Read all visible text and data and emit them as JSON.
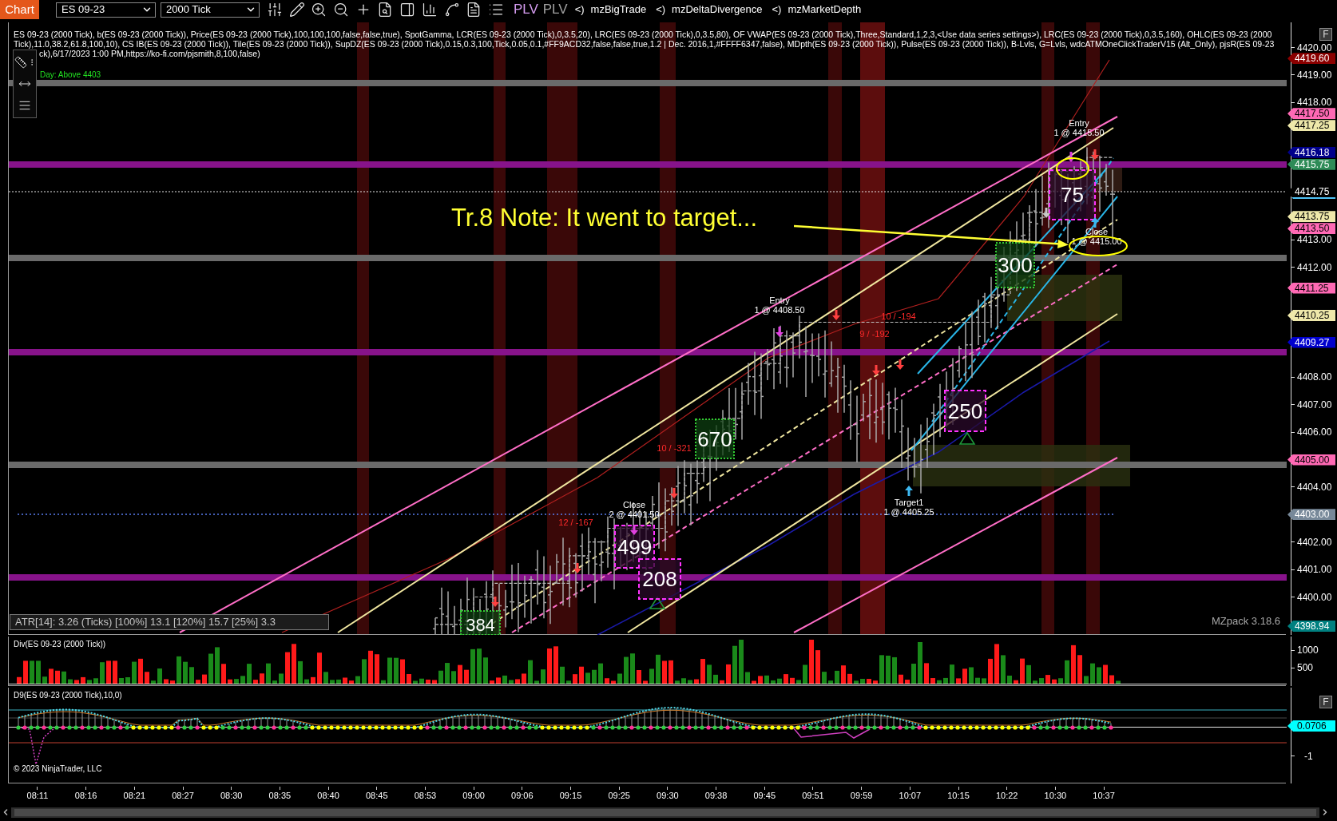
{
  "toolbar": {
    "tab": "Chart",
    "instrument": "ES 09-23",
    "interval": "2000 Tick",
    "plv": [
      {
        "label": "PLV",
        "on": true
      },
      {
        "label": "PLV",
        "on": false
      }
    ],
    "addons": [
      {
        "glyph": "<)",
        "label": "mzBigTrade"
      },
      {
        "glyph": "<)",
        "label": "mzDeltaDivergence"
      },
      {
        "glyph": "<)",
        "label": "mzMarketDepth"
      }
    ]
  },
  "price_panel": {
    "indicator_lines": [
      "ES 09-23 (2000 Tick), b(ES 09-23 (2000 Tick)), Price(ES 09-23 (2000 Tick),100,100,100,false,false,true), SpotGamma, LCR(ES 09-23 (2000 Tick),0,3.5,20), LRC(ES 09-23 (2000 Tick),0,3.5,80), OF VWAP(ES 09-23 (2000 Tick),Three,Standard,1,2,3,<Use data series settings>), LRC(ES 09-23 (2000 Tick),0,3.5,160), OHLC(ES 09-23 (2000",
      "Tick),11.0,38.2,61.8,100,10), CS IB(ES 09-23 (2000 Tick)), Tile(ES 09-23 (2000 Tick)), SupDZ(ES 09-23 (2000 Tick),0.15,0.3,100,Tick,0.05,0.1,#FF9ACD32,false,false,true,1.2 | Dec. 2016,1,#FFFF6347,false), MDpth(ES 09-23 (2000 Tick)), Pulse(ES 09-23 (2000 Tick)), B-Lvls, G=Lvls, wdcATMOneClickTraderV15 (Alt_Only), pjsR(ES 09-23",
      "ck),6/17/2023 1:00 PM,https://ko-fi.com/pjsmith,8,100,false)"
    ],
    "day_label": "Day: Above 4403",
    "note": "Tr.8 Note: It went to target...",
    "trade_labels": [
      {
        "title": "Entry",
        "detail": "1 @ 4408.50"
      },
      {
        "title": "Entry",
        "detail": "1 @ 4415.50"
      },
      {
        "title": "Close",
        "detail": "1 @ 4415.00"
      },
      {
        "title": "Close",
        "detail": "2 @ 4401.50"
      },
      {
        "title": "Target1",
        "detail": "1 @ 4405.25"
      }
    ],
    "pnl_labels": [
      "10 / -194",
      "9 / -192",
      "10 / -321",
      "12 / -167"
    ],
    "clusters": [
      {
        "kind": "buy",
        "value": "670"
      },
      {
        "kind": "sell",
        "value": "250"
      },
      {
        "kind": "buy",
        "value": "300"
      },
      {
        "kind": "sell",
        "value": "75"
      },
      {
        "kind": "sell",
        "value": "499"
      },
      {
        "kind": "sell",
        "value": "208"
      },
      {
        "kind": "buy",
        "value": "384"
      }
    ],
    "atr": "ATR[14]: 3.26 (Ticks) [100%] 13.1 [120%] 15.7 [25%] 3.3",
    "version": "MZpack 3.18.6"
  },
  "price_axis": {
    "f_button": "F",
    "ticks": [
      "4420.00",
      "4419.00",
      "4418.00",
      "4413.00",
      "4412.00",
      "4408.00",
      "4407.00",
      "4406.00",
      "4404.00",
      "4402.00",
      "4401.00",
      "4400.00"
    ],
    "markers": [
      {
        "kind": "level",
        "label": "4419.60",
        "color": "#8b0000"
      },
      {
        "kind": "level",
        "label": "4417.50",
        "color": "#ff69b4"
      },
      {
        "kind": "level",
        "label": "4417.25",
        "color": "#eee8aa"
      },
      {
        "kind": "level",
        "label": "4416.18",
        "color": "#00008b"
      },
      {
        "kind": "level",
        "label": "4415.75",
        "color": "#2e8b57"
      },
      {
        "kind": "last",
        "label": "4414.75",
        "color": "#000000"
      },
      {
        "kind": "level",
        "label": "4413.75",
        "color": "#eee8aa"
      },
      {
        "kind": "level",
        "label": "4413.50",
        "color": "#ff69b4"
      },
      {
        "kind": "level",
        "label": "4411.25",
        "color": "#ff69b4"
      },
      {
        "kind": "level",
        "label": "4410.25",
        "color": "#eee8aa"
      },
      {
        "kind": "level",
        "label": "4409.27",
        "color": "#0000cd"
      },
      {
        "kind": "level",
        "label": "4405.00",
        "color": "#ff69b4"
      },
      {
        "kind": "level",
        "label": "4403.00",
        "color": "#778899"
      },
      {
        "kind": "level",
        "label": "4398.94",
        "color": "#008080"
      }
    ]
  },
  "div_panel": {
    "title": "Div(ES 09-23 (2000 Tick))",
    "ticks": [
      "1000",
      "500"
    ]
  },
  "d9_panel": {
    "title": "D9(ES 09-23 (2000 Tick),10,0)",
    "f_button": "F",
    "ticks": [
      "-1"
    ],
    "marker": {
      "label": "0.0706",
      "color": "#00ffff"
    },
    "copyright": "© 2023 NinjaTrader, LLC"
  },
  "time_axis": [
    "08:11",
    "08:16",
    "08:21",
    "08:27",
    "08:30",
    "08:35",
    "08:40",
    "08:45",
    "08:53",
    "09:00",
    "09:06",
    "09:15",
    "09:25",
    "09:30",
    "09:38",
    "09:45",
    "09:51",
    "09:59",
    "10:07",
    "10:15",
    "10:22",
    "10:30",
    "10:37"
  ]
}
